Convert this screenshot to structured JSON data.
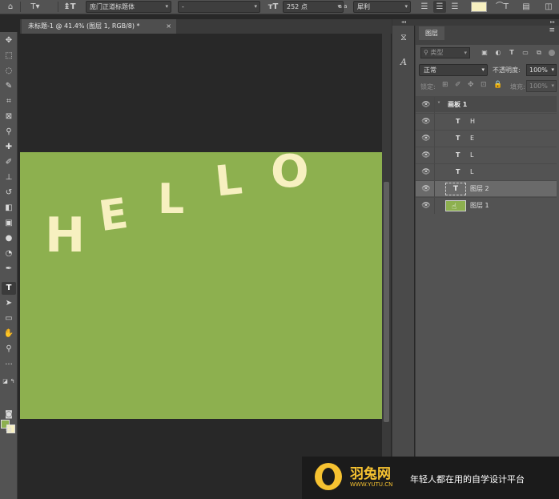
{
  "options_bar": {
    "font_family": "庞门正道标题体",
    "font_style": "-",
    "font_size": "252 点",
    "aa_label": "a a",
    "anti_alias": "犀利"
  },
  "document": {
    "tab_title": "未标题-1 @ 41.4% (图层 1, RGB/8) *",
    "close": "×",
    "artboard_text": [
      "H",
      "E",
      "L",
      "L",
      "O"
    ]
  },
  "layers_panel": {
    "tab": "图层",
    "filter_placeholder": "类型",
    "blend_mode": "正常",
    "opacity_label": "不透明度:",
    "opacity_value": "100%",
    "lock_label": "锁定:",
    "fill_label": "填充:",
    "fill_value": "100%",
    "artboard_name": "画板 1",
    "text_layers": [
      "H",
      "E",
      "L",
      "L"
    ],
    "text_thumb": "T",
    "layer2": "图层 2",
    "layer1": "图层 1"
  },
  "banner": {
    "brand": "羽兔网",
    "url": "WWW.YUTU.CN",
    "slogan": "年轻人都在用的自学设计平台"
  },
  "colors": {
    "artboard_fill": "#8db04f",
    "letter_fill": "#f7f0c0",
    "foreground": "#8db04f",
    "background": "#f7f0c0",
    "brand_yellow": "#f6c231"
  }
}
